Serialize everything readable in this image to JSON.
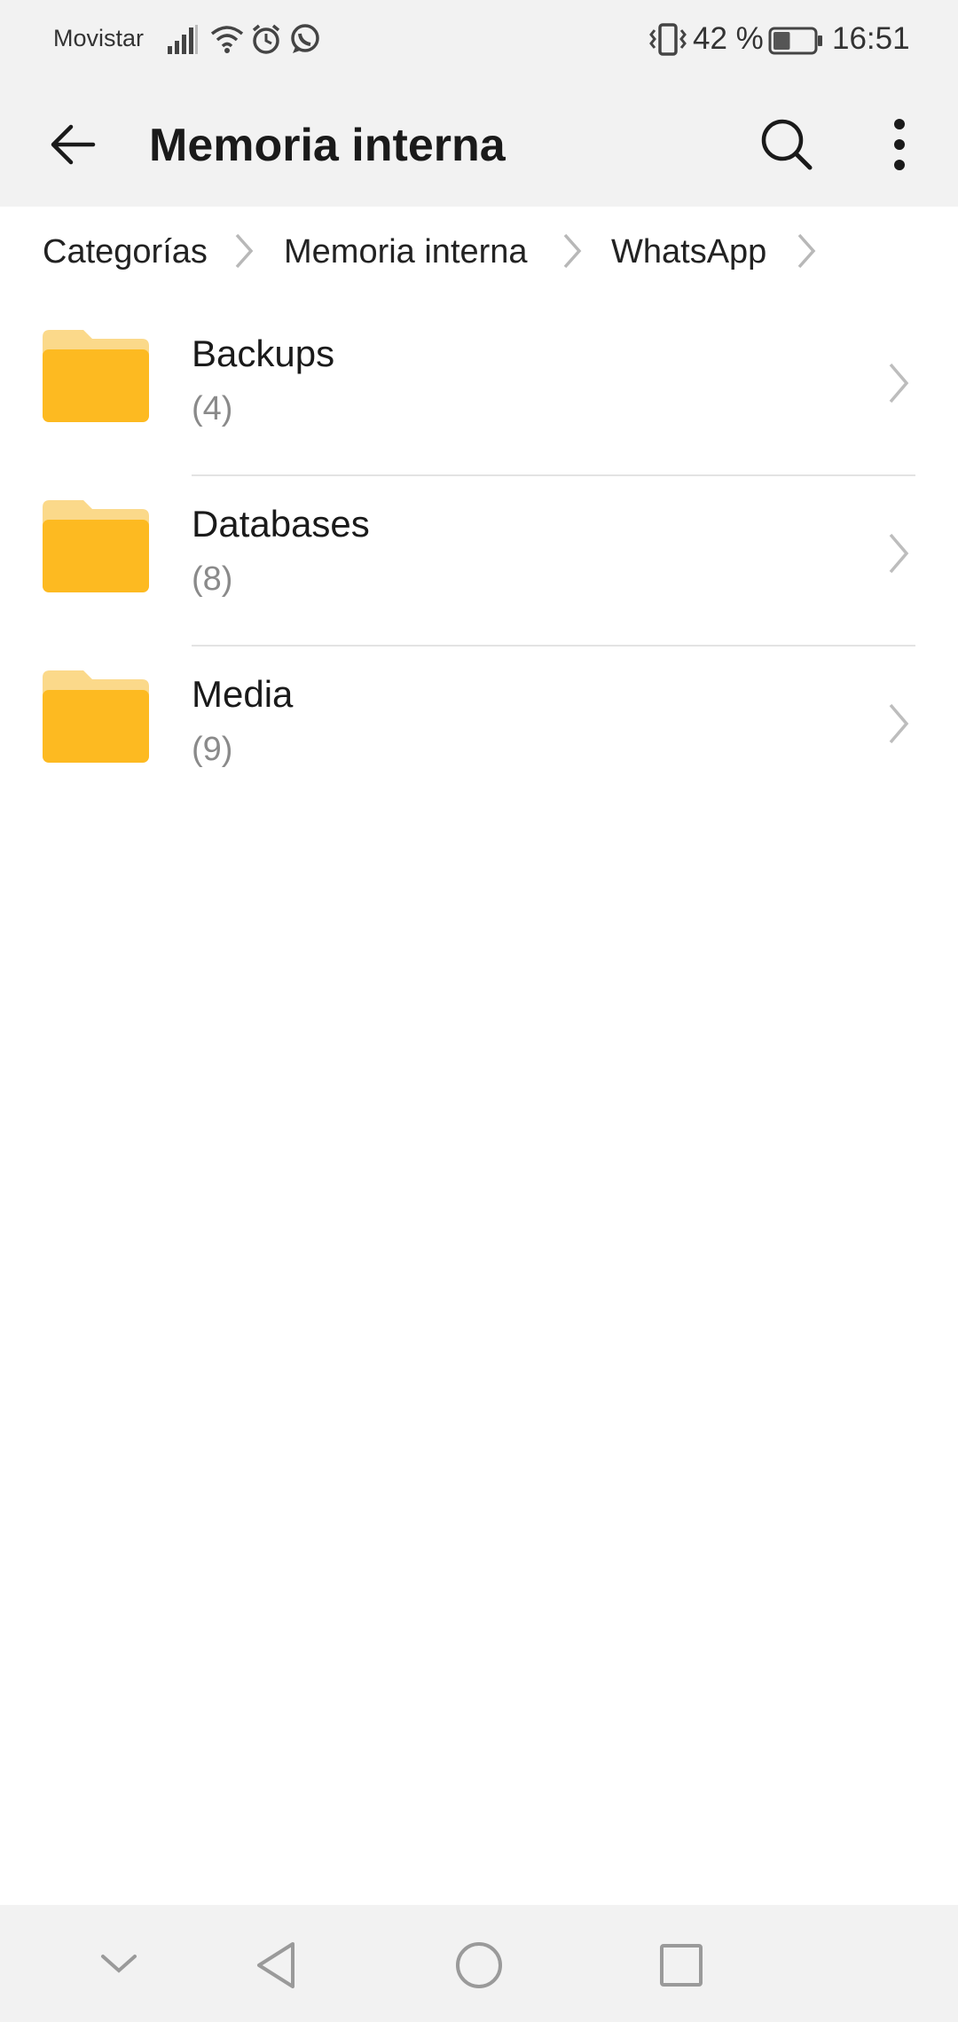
{
  "status_bar": {
    "carrier": "Movistar",
    "battery_percent": "42 %",
    "time": "16:51",
    "icons": [
      "signal-icon",
      "wifi-icon",
      "alarm-icon",
      "whatsapp-icon",
      "vibrate-icon",
      "battery-icon"
    ],
    "battery_level": 0.42
  },
  "toolbar": {
    "title": "Memoria interna",
    "back_icon": "arrow-left-icon",
    "search_icon": "search-icon",
    "menu_icon": "more-vertical-icon"
  },
  "breadcrumb": {
    "items": [
      "Categorías",
      "Memoria interna",
      "WhatsApp"
    ]
  },
  "files": [
    {
      "name": "Backups",
      "count": "(4)"
    },
    {
      "name": "Databases",
      "count": "(8)"
    },
    {
      "name": "Media",
      "count": "(9)"
    }
  ],
  "colors": {
    "folder_back": "#FBD98A",
    "folder_front": "#FDBA21",
    "header_bg": "#F2F2F2",
    "secondary_text": "#8A8A8A"
  },
  "nav_bar": {
    "icons": [
      "chevron-down-icon",
      "back-triangle-icon",
      "home-circle-icon",
      "recents-square-icon"
    ]
  }
}
